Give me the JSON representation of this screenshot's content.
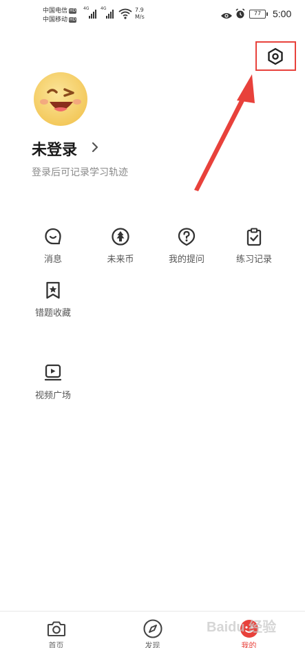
{
  "status_bar": {
    "carrier1": "中国电信",
    "carrier2": "中国移动",
    "hd": "HD",
    "net1": "4G",
    "net2": "4G",
    "speed_value": "7.9",
    "speed_unit": "M/s",
    "battery": "77",
    "time": "5:00"
  },
  "profile": {
    "title": "未登录",
    "subtitle": "登录后可记录学习轨迹"
  },
  "menu": {
    "items": [
      {
        "label": "消息",
        "icon": "message-icon"
      },
      {
        "label": "未来币",
        "icon": "tree-coin-icon"
      },
      {
        "label": "我的提问",
        "icon": "question-icon"
      },
      {
        "label": "练习记录",
        "icon": "clipboard-check-icon"
      },
      {
        "label": "错题收藏",
        "icon": "bookmark-star-icon"
      },
      {
        "label": "视频广场",
        "icon": "video-play-icon"
      }
    ]
  },
  "bottom_nav": {
    "items": [
      {
        "label": "首页",
        "icon": "camera-icon"
      },
      {
        "label": "发现",
        "icon": "compass-icon"
      },
      {
        "label": "我的",
        "icon": "profile-icon"
      }
    ]
  },
  "watermark": "Baidu 经验",
  "colors": {
    "accent": "#e8413b",
    "text_primary": "#1a1a1a",
    "text_secondary": "#8a8a8a"
  }
}
